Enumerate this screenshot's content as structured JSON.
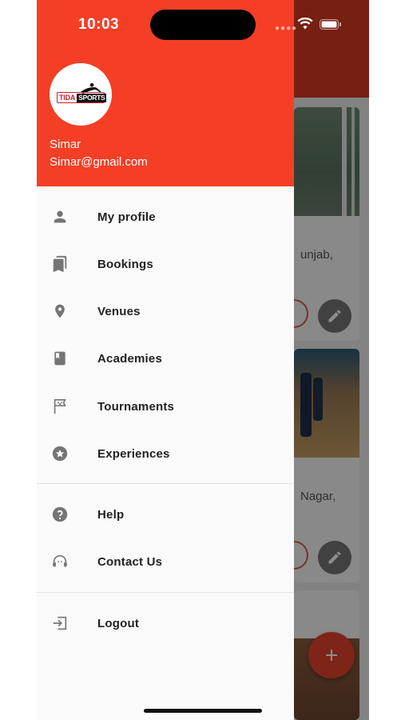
{
  "status_bar": {
    "time": "10:03"
  },
  "drawer": {
    "header": {
      "logo_text_left": "TIDA",
      "logo_text_right": "SPORTS",
      "user_name": "Simar",
      "user_email": "Simar@gmail.com"
    },
    "items": [
      {
        "label": "My profile",
        "icon": "person-icon"
      },
      {
        "label": "Bookings",
        "icon": "bookmarks-icon"
      },
      {
        "label": "Venues",
        "icon": "location-pin-icon"
      },
      {
        "label": "Academies",
        "icon": "book-icon"
      },
      {
        "label": "Tournaments",
        "icon": "flag-icon"
      },
      {
        "label": "Experiences",
        "icon": "star-circle-icon"
      },
      {
        "label": "Help",
        "icon": "help-circle-icon"
      },
      {
        "label": "Contact Us",
        "icon": "support-agent-icon"
      },
      {
        "label": "Logout",
        "icon": "logout-icon"
      }
    ]
  },
  "background": {
    "card1_text": "unjab,",
    "card2_text": "Nagar,"
  },
  "colors": {
    "drawer_header": "#f43f26",
    "app_bar": "#d93a22",
    "fab": "#e5422c",
    "icon_gray": "#757575"
  }
}
